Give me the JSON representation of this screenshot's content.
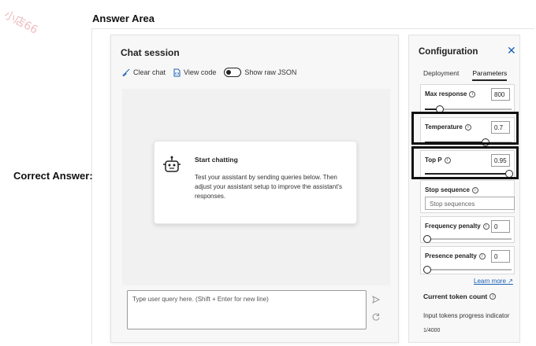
{
  "header": {
    "title": "Answer Area",
    "label": "Correct Answer:",
    "watermark": "小店66"
  },
  "chat": {
    "title": "Chat session",
    "toolbar": {
      "clear_chat": "Clear chat",
      "view_code": "View code",
      "show_raw_json": "Show raw JSON"
    },
    "start_card": {
      "title": "Start chatting",
      "description": "Test your assistant by sending queries below. Then adjust your assistant setup to improve the assistant's responses."
    },
    "input_placeholder": "Type user query here. (Shift + Enter for new line)"
  },
  "config": {
    "title": "Configuration",
    "tabs": [
      {
        "label": "Deployment",
        "active": false
      },
      {
        "label": "Parameters",
        "active": true
      }
    ],
    "params": {
      "max_response": {
        "label": "Max response",
        "value": "800",
        "level": 0.17
      },
      "temperature": {
        "label": "Temperature",
        "value": "0.7",
        "level": 0.7
      },
      "top_p": {
        "label": "Top P",
        "value": "0.95",
        "level": 1.0
      },
      "stop_sequence": {
        "label": "Stop sequence",
        "placeholder": "Stop sequences"
      },
      "frequency_penalty": {
        "label": "Frequency penalty",
        "value": "0",
        "level": 0.0
      },
      "presence_penalty": {
        "label": "Presence penalty",
        "value": "0",
        "level": 0.0
      }
    },
    "learn_more": "Learn more",
    "token_title": "Current token count",
    "token_indicator": "Input tokens progress indicator",
    "token_count": "1/4000"
  },
  "colors": {
    "accent": "#1a5fb4",
    "highlight_border": "#111111"
  }
}
